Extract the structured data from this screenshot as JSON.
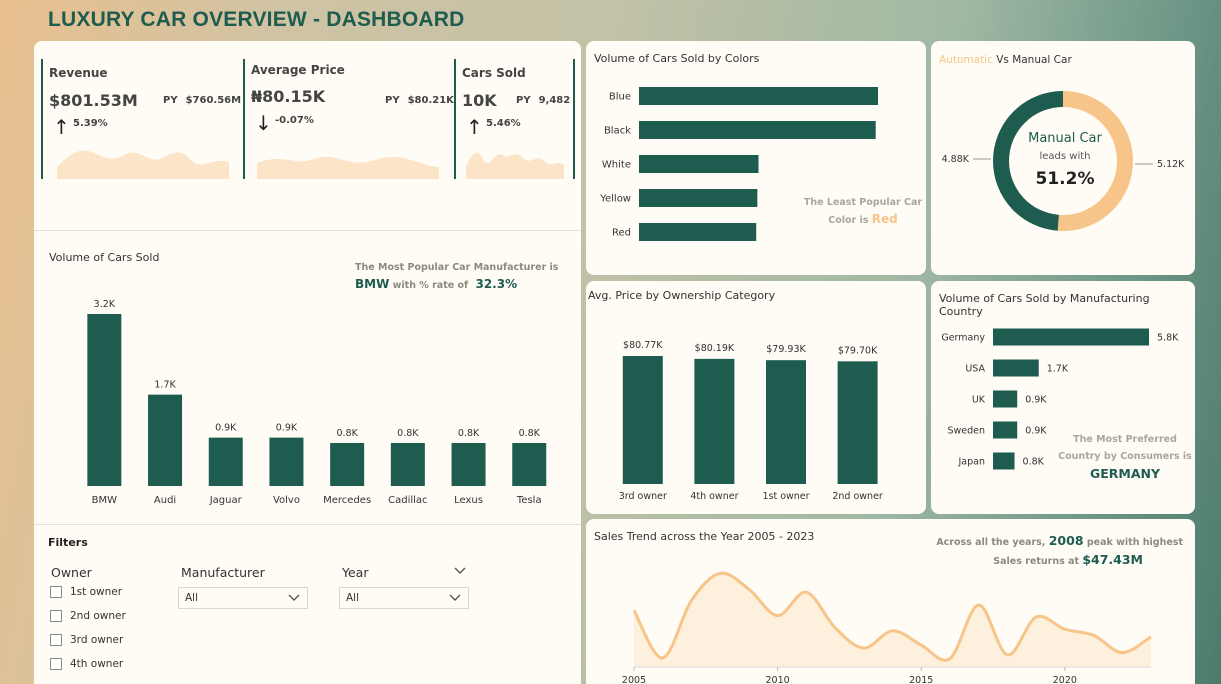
{
  "title": "LUXURY CAR OVERVIEW - DASHBOARD",
  "kpis": [
    {
      "label": "Revenue",
      "value": "$801.53M",
      "py_label": "PY",
      "py_value": "$760.56M",
      "change": "5.39%",
      "direction": "up"
    },
    {
      "label": "Average Price",
      "value": "₦80.15K",
      "py_label": "PY",
      "py_value": "$80.21K",
      "change": "-0.07%",
      "direction": "down"
    },
    {
      "label": "Cars Sold",
      "value": "10K",
      "py_label": "PY",
      "py_value": "9,482",
      "change": "5.46%",
      "direction": "up"
    }
  ],
  "manufacturer_chart": {
    "title": "Volume of Cars Sold",
    "note_line1": "The Most Popular Car Manufacturer  is",
    "note_name": "BMW",
    "note_mid": "with % rate of",
    "note_value": "32.3%"
  },
  "filters": {
    "title": "Filters",
    "owner_label": "Owner",
    "owners": [
      "1st owner",
      "2nd owner",
      "3rd owner",
      "4th owner"
    ],
    "manufacturer_label": "Manufacturer",
    "manufacturer_value": "All",
    "year_label": "Year",
    "year_value": "All"
  },
  "colors_chart": {
    "title": "Volume of Cars Sold by Colors",
    "note_line1": "The Least Popular Car",
    "note_line2": "Color is",
    "note_value": "Red"
  },
  "donut": {
    "title_accent": "Automatic",
    "title_rest": " Vs Manual Car",
    "center_title": "Manual Car",
    "center_sub": "leads with",
    "center_value": "51.2%",
    "left_label": "4.88K",
    "right_label": "5.12K"
  },
  "ownership_chart": {
    "title": "Avg. Price by Ownership Category"
  },
  "country_chart": {
    "title": "Volume of Cars Sold by Manufacturing Country",
    "note_line1": "The Most Preferred",
    "note_line2": "Country by Consumers is",
    "note_value": "GERMANY"
  },
  "trend_chart": {
    "title": "Sales Trend across the Year 2005 - 2023",
    "note_pre": "Across all the years,",
    "note_year": "2008",
    "note_post": "peak with highest",
    "note_line2": "Sales returns at",
    "note_value": "$47.43M"
  },
  "colors": {
    "primary": "#1f5c50",
    "accent": "#f7c48a",
    "card": "#fffcf5"
  },
  "chart_data": [
    {
      "type": "bar",
      "title": "Volume of Cars Sold",
      "categories": [
        "BMW",
        "Audi",
        "Jaguar",
        "Volvo",
        "Mercedes",
        "Cadillac",
        "Lexus",
        "Tesla"
      ],
      "values": [
        3.2,
        1.7,
        0.9,
        0.9,
        0.8,
        0.8,
        0.8,
        0.8
      ],
      "labels": [
        "3.2K",
        "1.7K",
        "0.9K",
        "0.9K",
        "0.8K",
        "0.8K",
        "0.8K",
        "0.8K"
      ],
      "grid": false
    },
    {
      "type": "bar",
      "orientation": "horizontal",
      "title": "Volume of Cars Sold by Colors",
      "categories": [
        "Blue",
        "Black",
        "White",
        "Yellow",
        "Red"
      ],
      "values": [
        2.1,
        2.08,
        1.05,
        1.04,
        1.03
      ],
      "grid": false
    },
    {
      "type": "pie",
      "title": "Automatic Vs Manual Car",
      "categories": [
        "Automatic",
        "Manual"
      ],
      "values": [
        4.88,
        5.12
      ],
      "labels": [
        "4.88K",
        "5.12K"
      ]
    },
    {
      "type": "bar",
      "title": "Avg. Price by Ownership Category",
      "categories": [
        "3rd owner",
        "4th owner",
        "1st owner",
        "2nd owner"
      ],
      "values": [
        80.77,
        80.19,
        79.93,
        79.7
      ],
      "labels": [
        "$80.77K",
        "$80.19K",
        "$79.93K",
        "$79.70K"
      ],
      "grid": false
    },
    {
      "type": "bar",
      "orientation": "horizontal",
      "title": "Volume of Cars Sold by Manufacturing Country",
      "categories": [
        "Germany",
        "USA",
        "UK",
        "Sweden",
        "Japan"
      ],
      "values": [
        5.8,
        1.7,
        0.9,
        0.9,
        0.8
      ],
      "labels": [
        "5.8K",
        "1.7K",
        "0.9K",
        "0.9K",
        "0.8K"
      ],
      "grid": false
    },
    {
      "type": "area",
      "title": "Sales Trend across the Year 2005 - 2023",
      "x": [
        2005,
        2006,
        2007,
        2008,
        2009,
        2010,
        2011,
        2012,
        2013,
        2014,
        2015,
        2016,
        2017,
        2018,
        2019,
        2020,
        2021,
        2022,
        2023
      ],
      "values": [
        42.5,
        36.2,
        43.8,
        47.4,
        45.3,
        41.8,
        44.9,
        40.2,
        37.5,
        39.8,
        37.9,
        36.1,
        43.2,
        36.6,
        41.6,
        40.0,
        39.2,
        36.9,
        39.0
      ],
      "xticks": [
        2005,
        2010,
        2015,
        2020
      ],
      "grid": false
    }
  ]
}
